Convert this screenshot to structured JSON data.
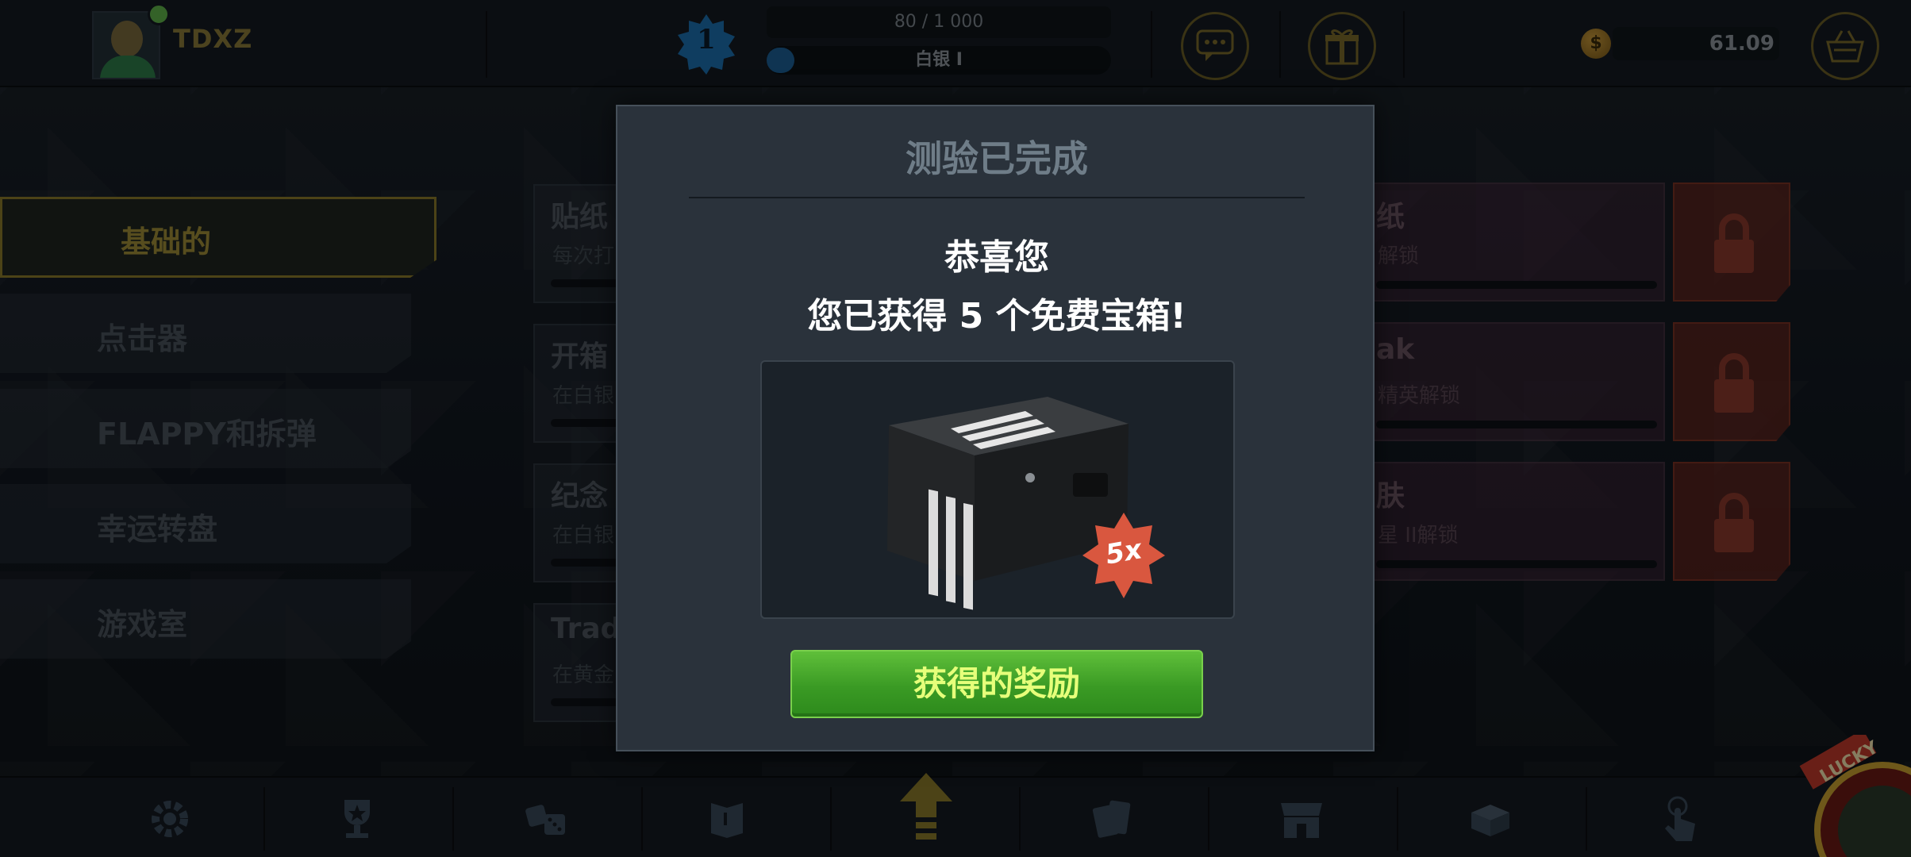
{
  "header": {
    "username": "TDXZ",
    "level": "1",
    "xp_text": "80 / 1 000",
    "xp_progress": 0.08,
    "rank_label": "白银 I",
    "balance": "61.09",
    "chat_icon": "chat-icon",
    "gift_icon": "gift-icon",
    "cart_icon": "basket-icon"
  },
  "sidebar": {
    "items": [
      {
        "label": "基础的",
        "active": true
      },
      {
        "label": "点击器"
      },
      {
        "label": "FLAPPY和拆弹"
      },
      {
        "label": "幸运转盘"
      },
      {
        "label": "游戏室"
      }
    ]
  },
  "cards": {
    "left": [
      {
        "title": "贴纸",
        "sub": "每次打"
      },
      {
        "title": "开箱",
        "sub": "在白银"
      },
      {
        "title": "纪念",
        "sub": "在白银"
      },
      {
        "title": "Trad",
        "sub": "在黄金"
      }
    ],
    "right": [
      {
        "title": "纸",
        "sub": "解锁"
      },
      {
        "title": "ak",
        "sub": "精英解锁"
      },
      {
        "title": "肤",
        "sub": "星 II解锁"
      }
    ]
  },
  "modal": {
    "title": "测验已完成",
    "congrats": "恭喜您",
    "reward_text": "您已获得 5 个免费宝箱!",
    "badge": "5x",
    "claim_label": "获得的奖励"
  },
  "bottom_nav": [
    "gear-icon",
    "trophy-icon",
    "dice-icon",
    "book-icon",
    "up-arrow-icon",
    "cards-icon",
    "shop-icon",
    "case-icon",
    "tap-icon"
  ],
  "lucky": {
    "label": "LUCKY"
  },
  "colors": {
    "accent_gold": "#8a7b2a",
    "claim_green": "#3a9a24",
    "lock_red": "#6e281e",
    "badge_red": "#d9573f"
  }
}
